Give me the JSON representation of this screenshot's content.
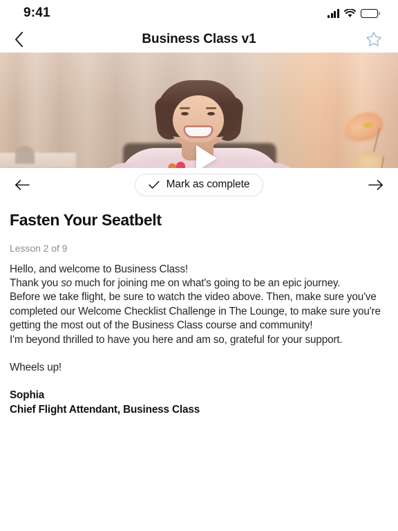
{
  "status_bar": {
    "time": "9:41",
    "signal_icon": "signal-bars-icon",
    "wifi_icon": "wifi-icon",
    "battery_icon": "battery-full-icon"
  },
  "header": {
    "back_icon": "chevron-left-icon",
    "title": "Business Class v1",
    "favorite_icon": "star-outline-icon",
    "favorite_color": "#a9c9e3"
  },
  "video": {
    "label": "video-thumbnail",
    "play_icon": "play-triangle-icon",
    "description": "Woman in pale pink dress with orange and red stripe detail, seated in front of peach curtains with flowers"
  },
  "lesson_nav": {
    "prev_icon": "arrow-left-icon",
    "next_icon": "arrow-right-icon",
    "complete_label": "Mark as complete",
    "complete_icon": "checkmark-icon"
  },
  "lesson": {
    "title": "Fasten Your Seatbelt",
    "meta": "Lesson 2 of 9",
    "paragraphs": [
      "Hello, and welcome to Business Class!",
      "Before we take flight, be sure to watch the video above. Then, make sure you've completed our Welcome Checklist Challenge in The Lounge, to make sure you're getting the most out of the Business Class course and community!",
      "I'm beyond thrilled to have you here and am so, grateful for your support.",
      "Wheels up!"
    ],
    "thanks_line": {
      "before": "Thank you ",
      "emphasis": "so",
      "after": " much for joining me on what's going to be an epic journey."
    },
    "signature_name": "Sophia",
    "signature_role": "Chief Flight Attendant, Business Class"
  }
}
